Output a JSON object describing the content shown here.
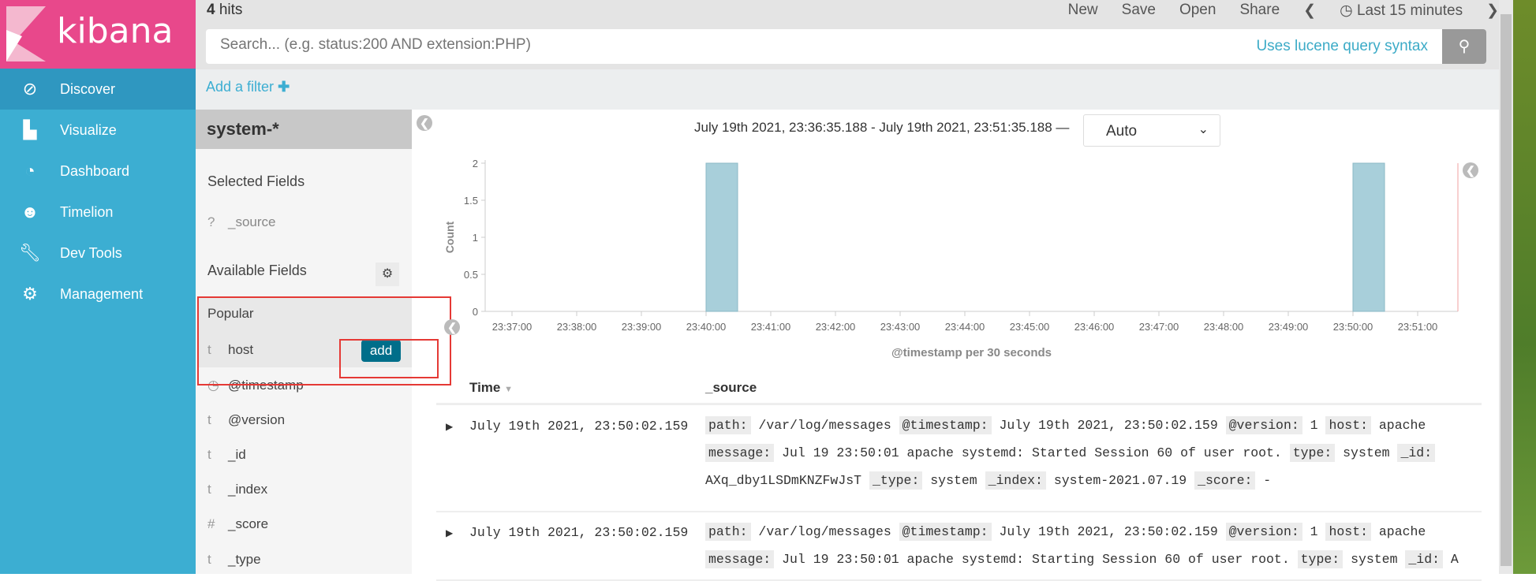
{
  "app": {
    "logo": "kibana",
    "hits_count": "4",
    "hits_label": "hits"
  },
  "sidebar": {
    "items": [
      {
        "label": "Discover",
        "icon": "compass-icon",
        "active": true
      },
      {
        "label": "Visualize",
        "icon": "bar-chart-icon"
      },
      {
        "label": "Dashboard",
        "icon": "dashboard-icon"
      },
      {
        "label": "Timelion",
        "icon": "timelion-icon"
      },
      {
        "label": "Dev Tools",
        "icon": "wrench-icon"
      },
      {
        "label": "Management",
        "icon": "gear-icon"
      }
    ]
  },
  "toolbar": {
    "new": "New",
    "save": "Save",
    "open": "Open",
    "share": "Share",
    "time": "Last 15 minutes"
  },
  "search": {
    "placeholder": "Search... (e.g. status:200 AND extension:PHP)",
    "hint": "Uses lucene query syntax"
  },
  "filter": {
    "add": "Add a filter"
  },
  "fields": {
    "index_pattern": "system-*",
    "selected_title": "Selected Fields",
    "available_title": "Available Fields",
    "popular_title": "Popular",
    "add_button": "add",
    "selected": [
      {
        "type": "?",
        "name": "_source"
      }
    ],
    "available": [
      {
        "type": "t",
        "name": "host"
      },
      {
        "type": "◷",
        "name": "@timestamp"
      },
      {
        "type": "t",
        "name": "@version"
      },
      {
        "type": "t",
        "name": "_id"
      },
      {
        "type": "t",
        "name": "_index"
      },
      {
        "type": "#",
        "name": "_score"
      },
      {
        "type": "t",
        "name": "_type"
      }
    ]
  },
  "histogram": {
    "range": "July 19th 2021, 23:36:35.188 - July 19th 2021, 23:51:35.188 —",
    "interval": "Auto"
  },
  "chart_data": {
    "type": "bar",
    "xlabel": "@timestamp per 30 seconds",
    "ylabel": "Count",
    "ylim": [
      0,
      2
    ],
    "yticks": [
      "0",
      "0.5",
      "1",
      "1.5",
      "2"
    ],
    "xticks": [
      "23:37:00",
      "23:38:00",
      "23:39:00",
      "23:40:00",
      "23:41:00",
      "23:42:00",
      "23:43:00",
      "23:44:00",
      "23:45:00",
      "23:46:00",
      "23:47:00",
      "23:48:00",
      "23:49:00",
      "23:50:00",
      "23:51:00"
    ],
    "bars": [
      {
        "x": "23:40:00",
        "value": 2
      },
      {
        "x": "23:50:00",
        "value": 2
      }
    ],
    "bar_color": "#a8cfda"
  },
  "table": {
    "col_time": "Time",
    "col_source": "_source",
    "rows": [
      {
        "time": "July 19th 2021, 23:50:02.159",
        "fields": [
          [
            "path:",
            "/var/log/messages"
          ],
          [
            "@timestamp:",
            "July 19th 2021, 23:50:02.159"
          ],
          [
            "@version:",
            "1"
          ],
          [
            "host:",
            "apache"
          ],
          [
            "message:",
            "Jul 19 23:50:01 apache systemd: Started Session 60 of user root."
          ],
          [
            "type:",
            "system"
          ],
          [
            "_id:",
            "AXq_dby1LSDmKNZFwJsT"
          ],
          [
            "_type:",
            "system"
          ],
          [
            "_index:",
            "system-2021.07.19"
          ],
          [
            "_score:",
            " -"
          ]
        ]
      },
      {
        "time": "July 19th 2021, 23:50:02.159",
        "fields": [
          [
            "path:",
            "/var/log/messages"
          ],
          [
            "@timestamp:",
            "July 19th 2021, 23:50:02.159"
          ],
          [
            "@version:",
            "1"
          ],
          [
            "host:",
            "apache"
          ],
          [
            "message:",
            "Jul 19 23:50:01 apache systemd: Starting Session 60 of user root."
          ],
          [
            "type:",
            "system"
          ],
          [
            "_id:",
            "A"
          ]
        ]
      }
    ]
  }
}
